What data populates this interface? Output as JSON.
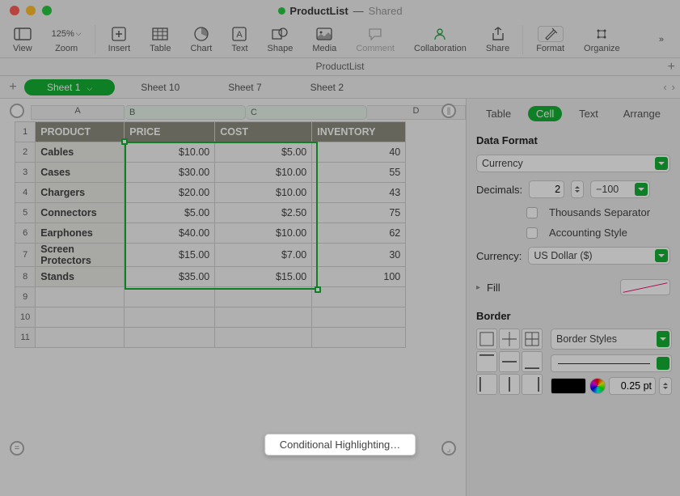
{
  "title": {
    "docname": "ProductList",
    "shared": "Shared"
  },
  "toolbar": {
    "view": "View",
    "zoom": "Zoom",
    "zoomval": "125%",
    "insert": "Insert",
    "table": "Table",
    "chart": "Chart",
    "text": "Text",
    "shape": "Shape",
    "media": "Media",
    "comment": "Comment",
    "collaboration": "Collaboration",
    "share": "Share",
    "format": "Format",
    "organize": "Organize"
  },
  "docbar": "ProductList",
  "sheets": [
    "Sheet 1",
    "Sheet 10",
    "Sheet 7",
    "Sheet 2"
  ],
  "columns": [
    "A",
    "B",
    "C",
    "D"
  ],
  "headers": [
    "PRODUCT",
    "PRICE",
    "COST",
    "INVENTORY"
  ],
  "rows": [
    {
      "product": "Cables",
      "price": "$10.00",
      "cost": "$5.00",
      "inv": "40"
    },
    {
      "product": "Cases",
      "price": "$30.00",
      "cost": "$10.00",
      "inv": "55"
    },
    {
      "product": "Chargers",
      "price": "$20.00",
      "cost": "$10.00",
      "inv": "43"
    },
    {
      "product": "Connectors",
      "price": "$5.00",
      "cost": "$2.50",
      "inv": "75"
    },
    {
      "product": "Earphones",
      "price": "$40.00",
      "cost": "$10.00",
      "inv": "62"
    },
    {
      "product": "Screen Protectors",
      "price": "$15.00",
      "cost": "$7.00",
      "inv": "30"
    },
    {
      "product": "Stands",
      "price": "$35.00",
      "cost": "$15.00",
      "inv": "100"
    }
  ],
  "emptyRows": [
    "9",
    "10",
    "11"
  ],
  "inspector": {
    "tabs": {
      "table": "Table",
      "cell": "Cell",
      "text": "Text",
      "arrange": "Arrange"
    },
    "dataFormat": "Data Format",
    "formatType": "Currency",
    "decimalsLabel": "Decimals:",
    "decimalsVal": "2",
    "negFormat": "−100",
    "thousands": "Thousands Separator",
    "accounting": "Accounting Style",
    "currencyLabel": "Currency:",
    "currencyVal": "US Dollar ($)",
    "fill": "Fill",
    "border": "Border",
    "borderStyles": "Border Styles",
    "borderWidth": "0.25 pt",
    "conditional": "Conditional Highlighting…"
  }
}
